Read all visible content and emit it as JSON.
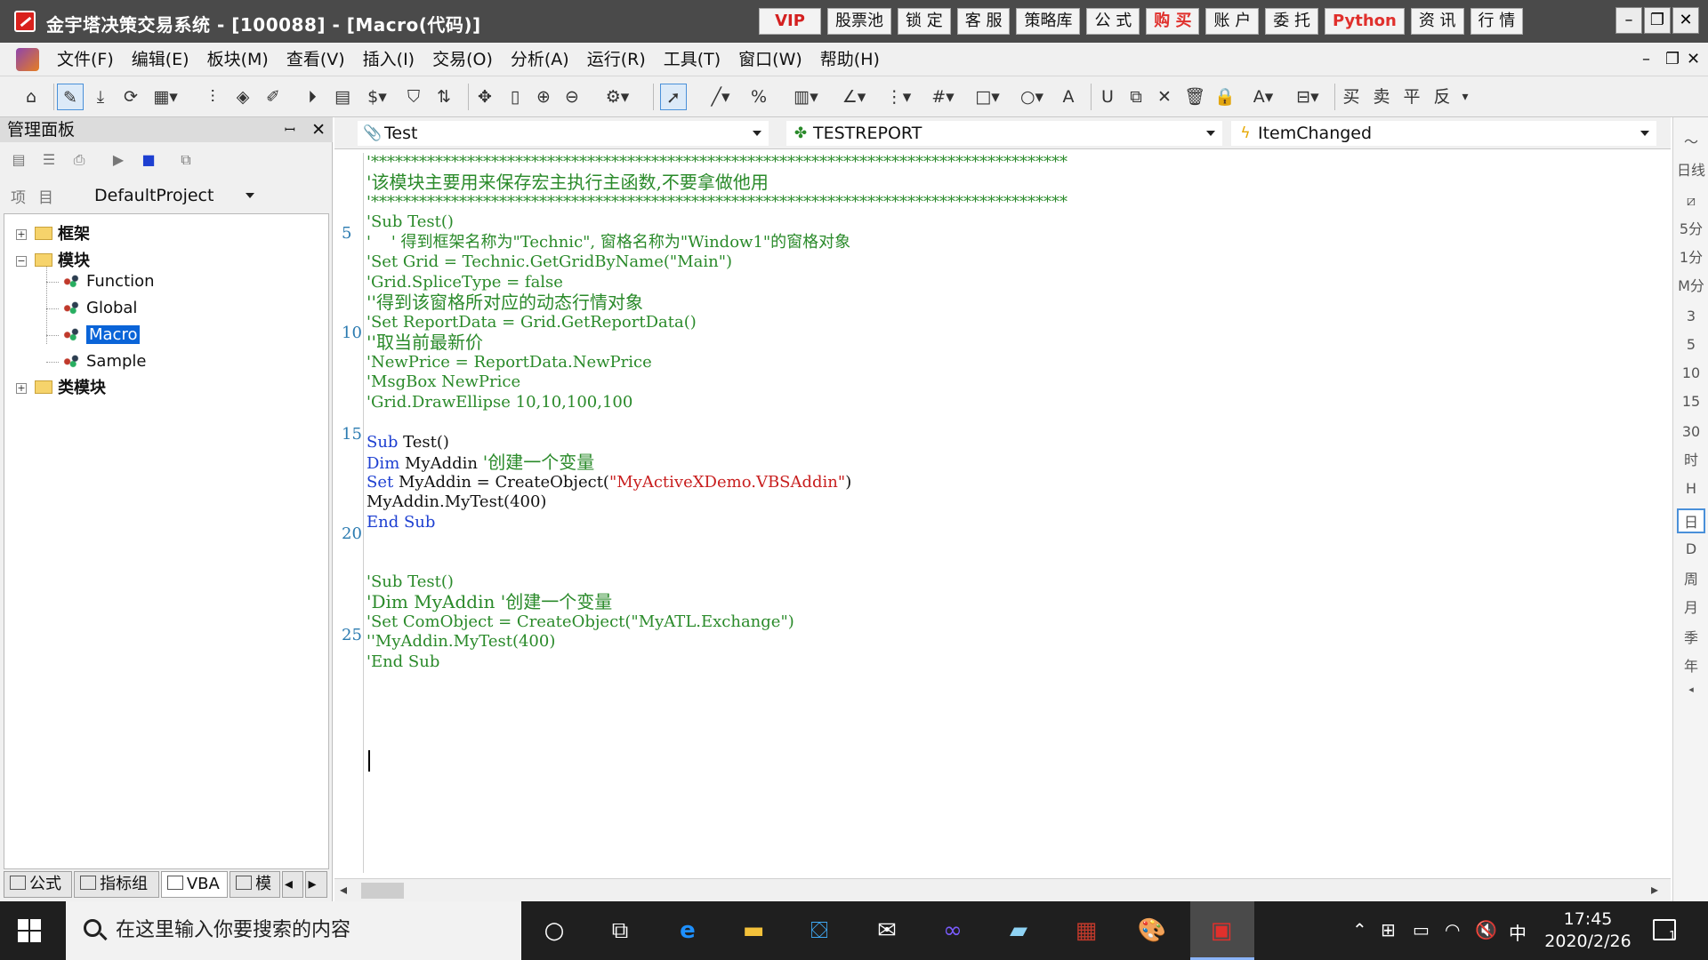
{
  "window": {
    "title": "金宇塔决策交易系统 - [100088] - [Macro(代码)]",
    "quick_buttons": [
      "VIP",
      "股票池",
      "锁 定",
      "客 服",
      "策略库",
      "公 式",
      "购 买",
      "账 户",
      "委 托",
      "Python",
      "资 讯",
      "行 情"
    ],
    "controls": [
      "–",
      "❐",
      "✕"
    ]
  },
  "menu": {
    "items": [
      "文件(F)",
      "编辑(E)",
      "板块(M)",
      "查看(V)",
      "插入(I)",
      "交易(O)",
      "分析(A)",
      "运行(R)",
      "工具(T)",
      "窗口(W)",
      "帮助(H)"
    ],
    "mdi_controls": [
      "–",
      "❐",
      "✕"
    ]
  },
  "toolbar": {
    "icons": [
      "home-icon",
      "edit-pen-icon",
      "download-icon",
      "refresh-icon",
      "grid-icon",
      "bars-icon",
      "diamond-icon",
      "pencil-icon",
      "play-circle-icon",
      "document-icon",
      "dollar-icon",
      "filter-icon",
      "exchange-icon",
      "move-icon",
      "ruler-icon",
      "zoom-in-icon",
      "zoom-out-icon",
      "gear-icon",
      "pointer-icon",
      "line-icon",
      "percent-icon",
      "columns-icon",
      "angle-icon",
      "bracket-icon",
      "hash-icon",
      "rect-icon",
      "circle-icon",
      "text-icon",
      "magnet-icon",
      "copy-icon",
      "delete-icon",
      "trash-icon",
      "lock-icon",
      "font-icon",
      "save-icon",
      "buy-icon",
      "sell-icon",
      "flat-icon",
      "reverse-icon"
    ],
    "trade_labels": [
      "买",
      "卖",
      "平",
      "反"
    ]
  },
  "right_strip": {
    "items": [
      "分时",
      "日线",
      "5分",
      "1分",
      "M分",
      "3",
      "5",
      "10",
      "15",
      "30",
      "时",
      "H",
      "日",
      "D",
      "周",
      "月",
      "季",
      "年"
    ]
  },
  "panel": {
    "title": "管理面板",
    "pin": "ꟷ",
    "close": "✕",
    "project_label": "项目",
    "project_value": "DefaultProject",
    "tree": [
      {
        "label": "框架",
        "type": "folder",
        "expander": "+"
      },
      {
        "label": "模块",
        "type": "folder",
        "expander": "−"
      },
      {
        "label": "Function",
        "type": "leaf"
      },
      {
        "label": "Global",
        "type": "leaf"
      },
      {
        "label": "Macro",
        "type": "leaf",
        "selected": true
      },
      {
        "label": "Sample",
        "type": "leaf"
      },
      {
        "label": "类模块",
        "type": "folder",
        "expander": "+"
      }
    ],
    "tabs": [
      "公式",
      "指标组",
      "VBA",
      "模"
    ]
  },
  "editor": {
    "object_combo": "Test",
    "module_combo": "TESTREPORT",
    "event_combo": "ItemChanged",
    "line_numbers": [
      "5",
      "10",
      "15",
      "20",
      "25"
    ],
    "code_lines": [
      "'***************************************************************************************",
      "'该模块主要用来保存宏主执行主函数,不要拿做他用",
      "'***************************************************************************************",
      "'Sub Test()",
      "'    ' 得到框架名称为\"Technic\", 窗格名称为\"Window1\"的窗格对象",
      "'Set Grid = Technic.GetGridByName(\"Main\")",
      "'Grid.SpliceType = false",
      "''得到该窗格所对应的动态行情对象",
      "'Set ReportData = Grid.GetReportData()",
      "''取当前最新价",
      "'NewPrice = ReportData.NewPrice",
      "'MsgBox NewPrice",
      "'Grid.DrawEllipse 10,10,100,100",
      "",
      "Sub Test()",
      "Dim MyAddin '创建一个变量",
      "Set MyAddin = CreateObject(\"MyActiveXDemo.VBSAddin\")",
      "MyAddin.MyTest(400)",
      "End Sub",
      "",
      "",
      "'Sub Test()",
      "'Dim MyAddin '创建一个变量",
      "'Set ComObject = CreateObject(\"MyATL.Exchange\")",
      "''MyAddin.MyTest(400)",
      "'End Sub"
    ],
    "code_tokens": {
      "sub_kw": "Sub",
      "sub_rest": " Test()",
      "dim_kw": "Dim",
      "dim_rest": " MyAddin ",
      "dim_cm": "'创建一个变量",
      "set_kw": "Set",
      "set_rest": " MyAddin = CreateObject(",
      "set_str": "\"MyActiveXDemo.VBSAddin\"",
      "set_end": ")",
      "call_line": "MyAddin.MyTest(400)",
      "end_kw": "End Sub"
    }
  },
  "taskbar": {
    "search_placeholder": "在这里输入你要搜索的内容",
    "time": "17:45",
    "date": "2020/2/26",
    "ime": "中",
    "notification_count": "1"
  }
}
